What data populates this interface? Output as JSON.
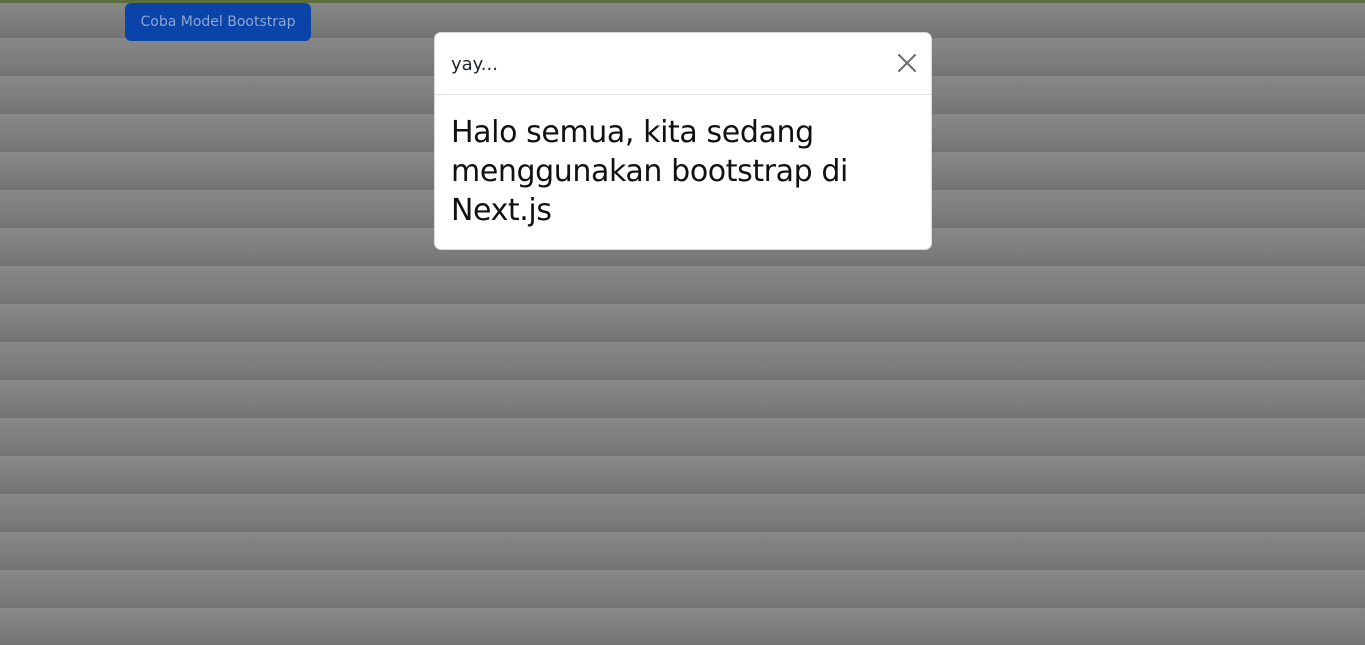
{
  "page": {
    "open_button_label": "Coba Model Bootstrap"
  },
  "modal": {
    "title": "yay...",
    "body_text": "Halo semua, kita sedang menggunakan bootstrap di Next.js",
    "close_icon": "close-icon"
  },
  "colors": {
    "primary_button": "#0a44a8",
    "backdrop": "#7a7a7a",
    "modal_background": "#ffffff"
  }
}
